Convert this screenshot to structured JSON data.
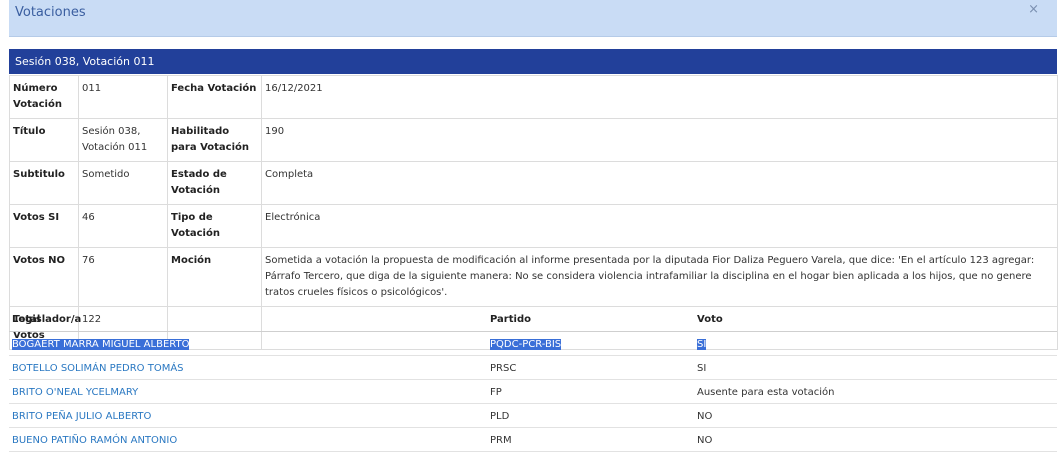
{
  "dialog": {
    "title": "Votaciones",
    "close": "×"
  },
  "session_header": "Sesión 038, Votación 011",
  "details": {
    "numero_label": "Número Votación",
    "numero_value": "011",
    "fecha_label": "Fecha Votación",
    "fecha_value": "16/12/2021",
    "titulo_label": "Título",
    "titulo_value": "Sesión 038, Votación 011",
    "habilitado_label": "Habilitado para Votación",
    "habilitado_value": "190",
    "subtitulo_label": "Subtitulo",
    "subtitulo_value": "Sometido",
    "estado_label": "Estado de Votación",
    "estado_value": "Completa",
    "si_label": "Votos SI",
    "si_value": "46",
    "tipo_label": "Tipo de Votación",
    "tipo_value": "Electrónica",
    "no_label": "Votos NO",
    "no_value": "76",
    "mocion_label": "Moción",
    "mocion_value": "Sometida a votación la propuesta de modificación al informe presentada por la diputada Fior Daliza Peguero Varela, que dice: 'En el artículo 123 agregar: Párrafo Tercero, que diga de la siguiente manera: No se considera violencia intrafamiliar la disciplina en el hogar bien aplicada a los hijos, que no genere tratos crueles físicos o psicológicos'.",
    "total_label": "Total Votos",
    "total_value": "122"
  },
  "votes_table": {
    "headers": {
      "legislator": "Legislador/a",
      "party": "Partido",
      "vote": "Voto"
    },
    "rows": [
      {
        "name": "BOGAERT MARRA MIGUEL ALBERTO",
        "party": "PQDC-PCR-BIS",
        "vote": "SI"
      },
      {
        "name": "BOTELLO SOLIMÁN PEDRO TOMÁS",
        "party": "PRSC",
        "vote": "SI"
      },
      {
        "name": "BRITO O'NEAL YCELMARY",
        "party": "FP",
        "vote": "Ausente para esta votación"
      },
      {
        "name": "BRITO PEÑA JULIO ALBERTO",
        "party": "PLD",
        "vote": "NO"
      },
      {
        "name": "BUENO PATIÑO RAMÓN ANTONIO",
        "party": "PRM",
        "vote": "NO"
      }
    ]
  }
}
